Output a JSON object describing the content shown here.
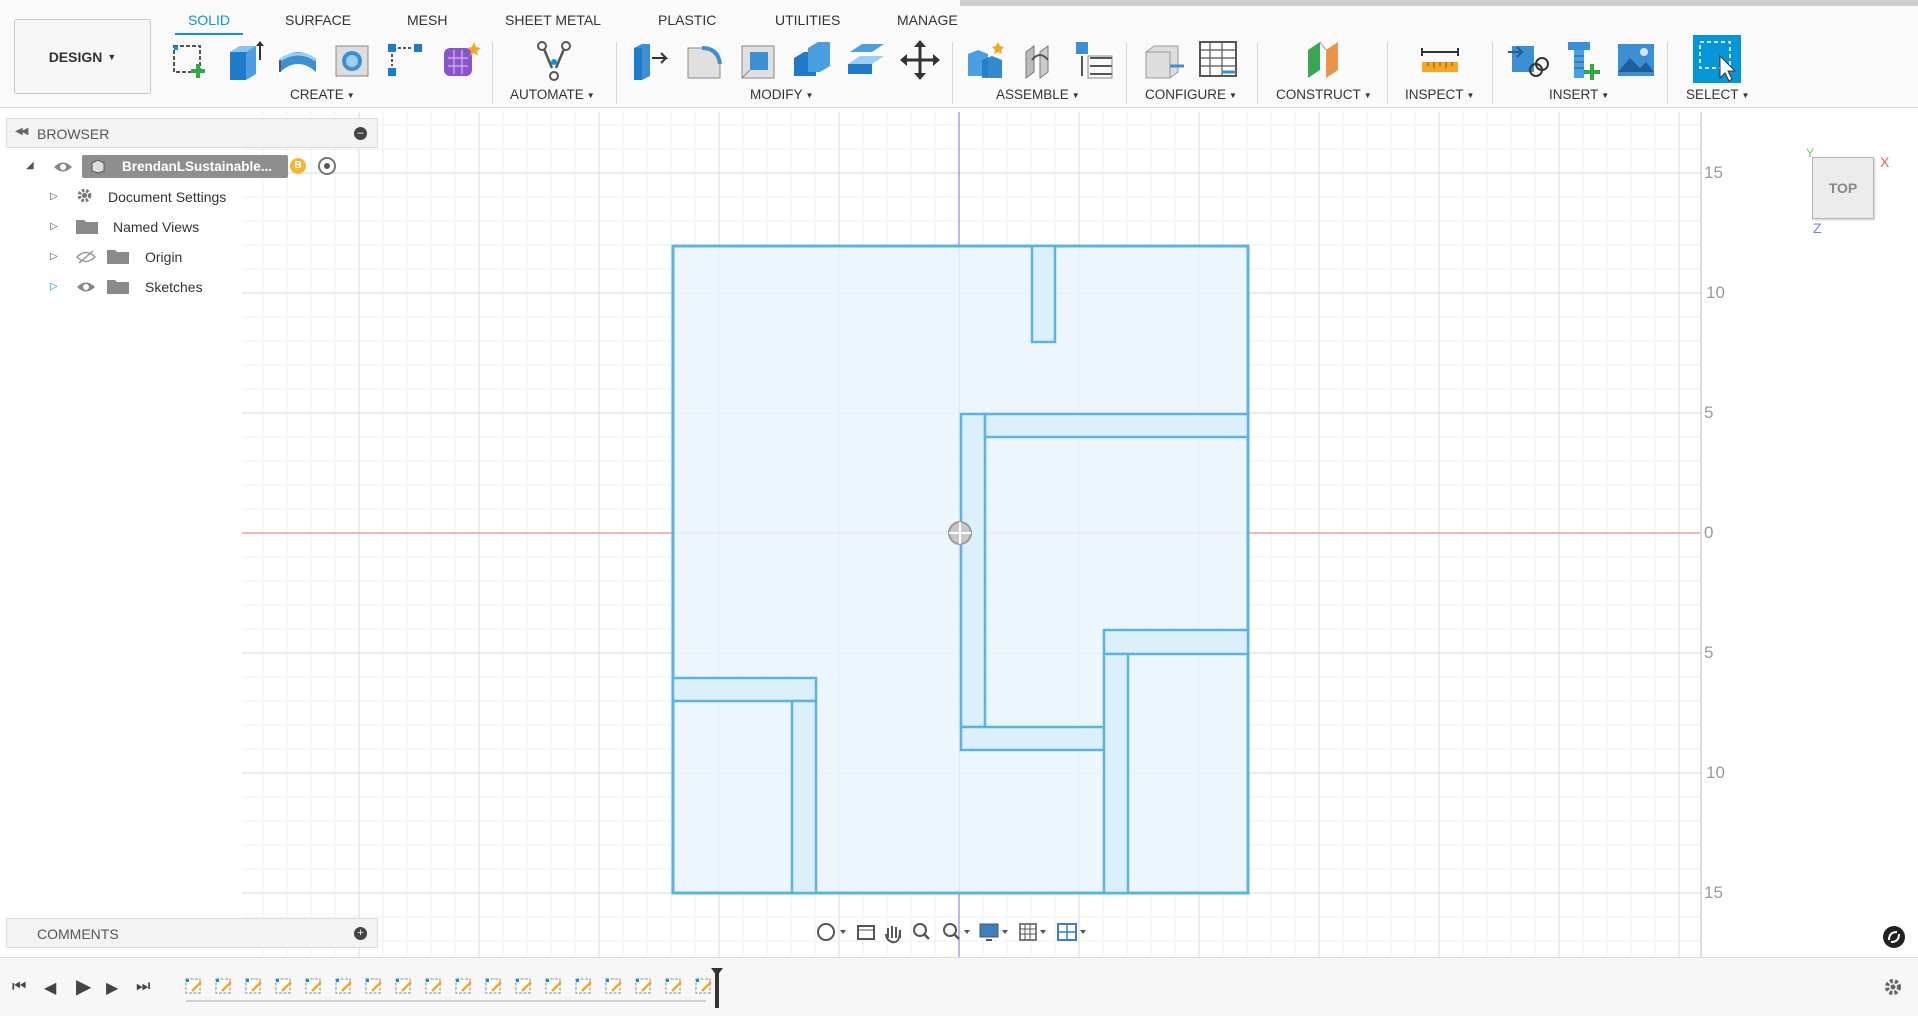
{
  "toolbar": {
    "workspace": "DESIGN",
    "tabs": [
      "SOLID",
      "SURFACE",
      "MESH",
      "SHEET METAL",
      "PLASTIC",
      "UTILITIES",
      "MANAGE"
    ],
    "groups": [
      "CREATE",
      "AUTOMATE",
      "MODIFY",
      "ASSEMBLE",
      "CONFIGURE",
      "CONSTRUCT",
      "INSPECT",
      "INSERT",
      "SELECT"
    ],
    "icons": {
      "create": [
        "create-sketch-icon",
        "extrude-icon",
        "revolve-icon",
        "hole-icon",
        "pattern-icon",
        "form-icon"
      ],
      "automate": [
        "automate-icon"
      ],
      "modify": [
        "press-pull-icon",
        "fillet-icon",
        "shell-icon",
        "combine-icon",
        "offset-face-icon",
        "move-icon"
      ],
      "assemble": [
        "new-component-icon",
        "joint-icon",
        "bom-icon"
      ],
      "configure": [
        "configure-icon",
        "table-icon"
      ],
      "construct": [
        "offset-plane-icon"
      ],
      "inspect": [
        "measure-icon"
      ],
      "insert": [
        "insert-derive-icon",
        "insert-mcmaster-icon",
        "insert-canvas-icon"
      ],
      "select": [
        "select-icon"
      ]
    }
  },
  "browser": {
    "title": "BROWSER",
    "root": "BrendanLSustainable...",
    "items": [
      "Document Settings",
      "Named Views",
      "Origin",
      "Sketches"
    ]
  },
  "comments": {
    "title": "COMMENTS"
  },
  "viewcube": {
    "face": "TOP",
    "axes": [
      "X",
      "Y",
      "Z"
    ]
  },
  "axis_labels": {
    "right": [
      "15",
      "10",
      "5",
      "0",
      "5",
      "10",
      "15"
    ]
  },
  "colors": {
    "accent": "#0696d7",
    "sketch_line": "#5bb4e0",
    "sketch_fill": "#e8f4fb",
    "x_axis": "#f08080",
    "y_axis": "#8080e0",
    "grid_major": "#d8d8d8",
    "grid_minor": "#efefef"
  },
  "timeline": {
    "controls": [
      "first-icon",
      "previous-icon",
      "play-icon",
      "next-icon",
      "last-icon"
    ],
    "item_count": 18
  }
}
